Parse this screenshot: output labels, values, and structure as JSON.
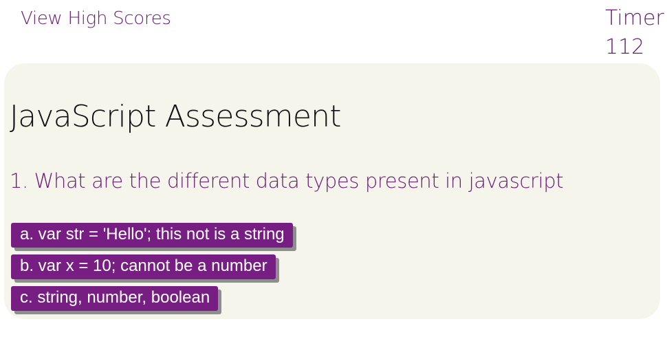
{
  "header": {
    "high_scores_label": "View High Scores",
    "timer_label": "Timer",
    "timer_value": "112"
  },
  "quiz": {
    "title": "JavaScript Assessment",
    "question": "1. What are the different data types present in javascript",
    "answers": [
      "a. var str = 'Hello'; this not is a string",
      "b. var x = 10; cannot be a number",
      "c. string, number, boolean"
    ]
  },
  "colors": {
    "accent": "#771e83",
    "card_background": "#f6f5ec",
    "text_purple": "#6b1a78"
  }
}
